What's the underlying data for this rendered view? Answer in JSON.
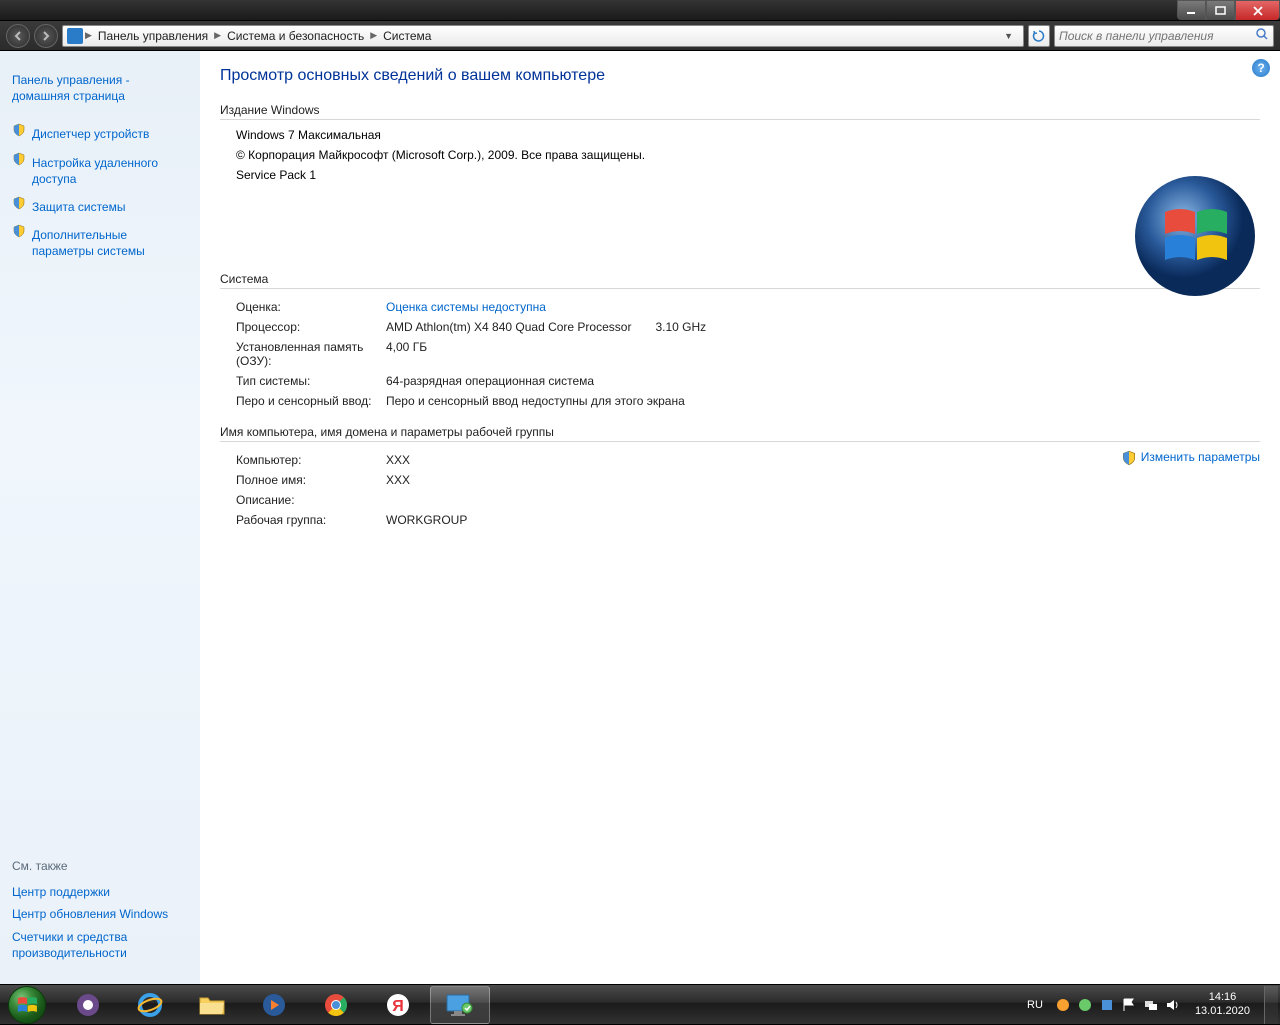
{
  "breadcrumb": {
    "items": [
      "Панель управления",
      "Система и безопасность",
      "Система"
    ]
  },
  "search": {
    "placeholder": "Поиск в панели управления"
  },
  "sidebar": {
    "home": "Панель управления - домашняя страница",
    "tasks": [
      "Диспетчер устройств",
      "Настройка удаленного доступа",
      "Защита системы",
      "Дополнительные параметры системы"
    ],
    "seealso_hdr": "См. также",
    "seealso": [
      "Центр поддержки",
      "Центр обновления Windows",
      "Счетчики и средства производительности"
    ]
  },
  "content": {
    "pagetitle": "Просмотр основных сведений о вашем компьютере",
    "edition_hdr": "Издание Windows",
    "edition_name": "Windows 7 Максимальная",
    "edition_copyright": "© Корпорация Майкрософт (Microsoft Corp.), 2009. Все права защищены.",
    "edition_sp": "Service Pack 1",
    "system_hdr": "Система",
    "rating_k": "Оценка:",
    "rating_v": "Оценка системы недоступна",
    "processor_k": "Процессор:",
    "processor_v": "AMD Athlon(tm) X4 840 Quad Core Processor",
    "processor_speed": "3.10 GHz",
    "ram_k": "Установленная память (ОЗУ):",
    "ram_v": "4,00 ГБ",
    "systype_k": "Тип системы:",
    "systype_v": "64-разрядная операционная система",
    "pen_k": "Перо и сенсорный ввод:",
    "pen_v": "Перо и сенсорный ввод недоступны для этого экрана",
    "name_hdr": "Имя компьютера, имя домена и параметры рабочей группы",
    "computer_k": "Компьютер:",
    "computer_v": "XXX",
    "fullname_k": "Полное имя:",
    "fullname_v": "XXX",
    "desc_k": "Описание:",
    "desc_v": "",
    "workgroup_k": "Рабочая группа:",
    "workgroup_v": "WORKGROUP",
    "change": "Изменить параметры"
  },
  "tray": {
    "lang": "RU",
    "time": "14:16",
    "date": "13.01.2020"
  }
}
